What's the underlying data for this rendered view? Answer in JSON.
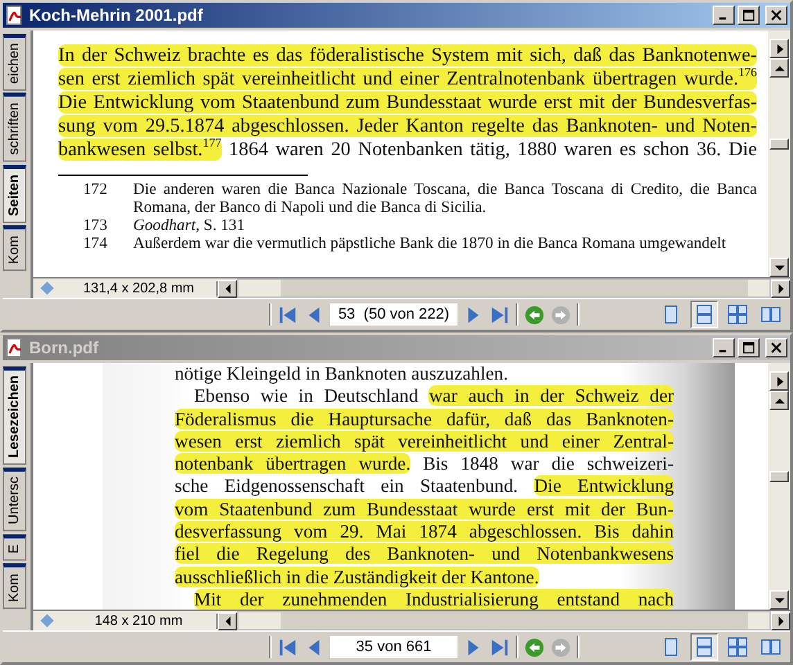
{
  "windows": [
    {
      "title": "Koch-Mehrin 2001.pdf",
      "active": true,
      "side_tabs": [
        {
          "label": "eichen",
          "selected": false
        },
        {
          "label": "schriften",
          "selected": false
        },
        {
          "label": "Seiten",
          "selected": true
        },
        {
          "label": "Kom",
          "selected": false
        }
      ],
      "text_lines": [
        {
          "kind": "full",
          "segments": [
            {
              "text": "In der Schweiz brachte es das föderalistische System mit sich, daß das Banknotenwe-",
              "highlighted": true
            }
          ]
        },
        {
          "kind": "full",
          "segments": [
            {
              "text": "sen erst ziemlich spät vereinheitlicht und einer Zentralnotenbank übertragen wurde.$^{176}$",
              "highlighted": true
            }
          ]
        },
        {
          "kind": "full",
          "segments": [
            {
              "text": "Die Entwicklung vom Staatenbund zum Bundesstaat wurde erst mit der Bundesverfas-",
              "highlighted": true
            }
          ]
        },
        {
          "kind": "full",
          "segments": [
            {
              "text": "sung vom 29.5.1874 abgeschlossen. Jeder Kanton regelte das Banknoten- und Noten-",
              "highlighted": true
            }
          ]
        },
        {
          "kind": "full",
          "segments": [
            {
              "text": "bankwesen selbst.$^{177}$",
              "highlighted": true
            },
            {
              "text": " 1864 waren 20 Notenbanken tätig, 1880 waren es schon 36. Die",
              "highlighted": false
            }
          ]
        }
      ],
      "footnotes": [
        {
          "number": "172",
          "text": "Die anderen waren die Banca Nazionale Toscana, die Banca Toscana di Credito, die Banca Romana, der Banco di Napoli und die Banca di Sicilia."
        },
        {
          "number": "173",
          "text": "*Goodhart*, S. 131"
        },
        {
          "number": "174",
          "text": "Außerdem war die vermutlich päpstliche Bank die 1870 in die Banca Romana umgewandelt"
        }
      ],
      "page_size": "131,4 x 202,8 mm",
      "page_field": "53  (50 von 222)",
      "view_modes": [
        {
          "kind": "single",
          "selected": false
        },
        {
          "kind": "continuous",
          "selected": true
        },
        {
          "kind": "facing-continuous",
          "selected": false
        },
        {
          "kind": "facing",
          "selected": false
        }
      ]
    },
    {
      "title": "Born.pdf",
      "active": false,
      "side_tabs": [
        {
          "label": "Lesezeichen",
          "selected": true
        },
        {
          "label": "Untersc",
          "selected": false
        },
        {
          "label": "E",
          "selected": false
        },
        {
          "label": "Kom",
          "selected": false
        }
      ],
      "text_lines": [
        {
          "kind": "last",
          "segments": [
            {
              "text": "nötige Kleingeld in Banknoten auszuzahlen.",
              "highlighted": false
            }
          ]
        },
        {
          "kind": "first",
          "segments": [
            {
              "text": "Ebenso wie in Deutschland ",
              "highlighted": false
            },
            {
              "text": "war auch in der Schweiz der",
              "highlighted": true
            }
          ]
        },
        {
          "kind": "full",
          "segments": [
            {
              "text": "Föderalismus die Hauptursache dafür, daß das Banknoten-",
              "highlighted": true
            }
          ]
        },
        {
          "kind": "full",
          "segments": [
            {
              "text": "wesen erst ziemlich spät vereinheitlicht und einer Zentral-",
              "highlighted": true
            }
          ]
        },
        {
          "kind": "full",
          "segments": [
            {
              "text": "notenbank übertragen wurde.",
              "highlighted": true
            },
            {
              "text": " Bis 1848 war die schweizeri-",
              "highlighted": false
            }
          ]
        },
        {
          "kind": "full",
          "segments": [
            {
              "text": "sche Eidgenossenschaft ein Staatenbund. ",
              "highlighted": false
            },
            {
              "text": "Die Entwicklung",
              "highlighted": true
            }
          ]
        },
        {
          "kind": "full",
          "segments": [
            {
              "text": "vom Staatenbund zum Bundesstaat wurde erst mit der Bun-",
              "highlighted": true
            }
          ]
        },
        {
          "kind": "full",
          "segments": [
            {
              "text": "desverfassung vom 29. Mai 1874 abgeschlossen. Bis dahin",
              "highlighted": true
            }
          ]
        },
        {
          "kind": "full",
          "segments": [
            {
              "text": "fiel die Regelung des Banknoten- und Notenbankwesens",
              "highlighted": true
            }
          ]
        },
        {
          "kind": "last",
          "segments": [
            {
              "text": "ausschließlich in die Zuständigkeit der Kantone.",
              "highlighted": true
            }
          ]
        },
        {
          "kind": "first",
          "segments": [
            {
              "text": "Mit der zunehmenden Industrialisierung entstand nach",
              "highlighted": true
            }
          ]
        }
      ],
      "page_size": "148 x 210 mm",
      "page_field": "35 von 661",
      "view_modes": [
        {
          "kind": "single",
          "selected": false
        },
        {
          "kind": "continuous",
          "selected": true
        },
        {
          "kind": "facing-continuous",
          "selected": false
        },
        {
          "kind": "facing",
          "selected": false
        }
      ]
    }
  ]
}
